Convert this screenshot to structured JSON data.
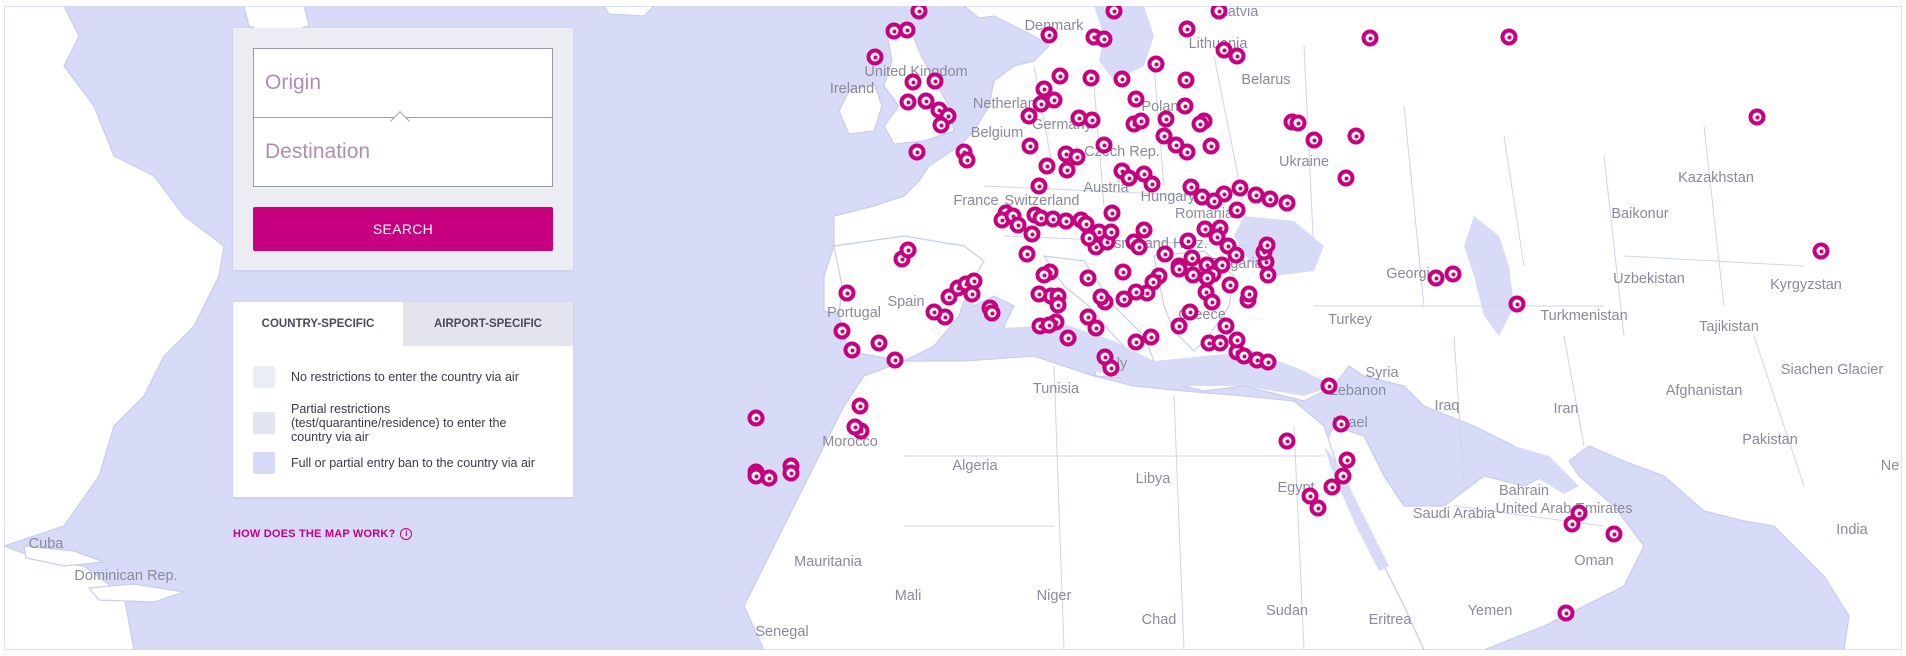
{
  "search": {
    "origin_placeholder": "Origin",
    "destination_placeholder": "Destination",
    "button_label": "SEARCH"
  },
  "legend": {
    "tabs": [
      "COUNTRY-SPECIFIC",
      "AIRPORT-SPECIFIC"
    ],
    "items": [
      {
        "label": "No restrictions to enter the country via air",
        "color": "#eceef6"
      },
      {
        "label": "Partial restrictions (test/quarantine/residence) to enter the country via air",
        "color": "#e3e5f2"
      },
      {
        "label": "Full or partial entry ban to the country via air",
        "color": "#d7dbf7"
      }
    ]
  },
  "help_link": "HOW DOES THE MAP WORK?",
  "help_icon": "info-icon",
  "marker_color": "#c6007e",
  "map_labels": [
    "Denmark",
    "Latvia",
    "Lithuania",
    "Belarus",
    "United Kingdom",
    "Ireland",
    "Netherlands",
    "Poland",
    "Belgium",
    "Germany",
    "Czech Rep.",
    "Ukraine",
    "Kazakhstan",
    "Baikonur",
    "France",
    "Switzerland",
    "Austria",
    "Hungary",
    "Romania",
    "Bosnia and Herz.",
    "Bulgaria",
    "Georgia",
    "Uzbekistan",
    "Kyrgyzstan",
    "Portugal",
    "Spain",
    "Turkmenistan",
    "Tajikistan",
    "Turkey",
    "Greece",
    "Italy",
    "Syria",
    "Lebanon",
    "Iraq",
    "Iran",
    "Afghanistan",
    "Siachen Glacier",
    "Tunisia",
    "Israel",
    "Pakistan",
    "Morocco",
    "Algeria",
    "Libya",
    "Egypt",
    "Bahrain",
    "United Arab Emirates",
    "Saudi Arabia",
    "India",
    "Ne",
    "Cuba",
    "Dominican Rep.",
    "Mauritania",
    "Mali",
    "Niger",
    "Chad",
    "Sudan",
    "Eritrea",
    "Yemen",
    "Oman",
    "Senegal"
  ]
}
